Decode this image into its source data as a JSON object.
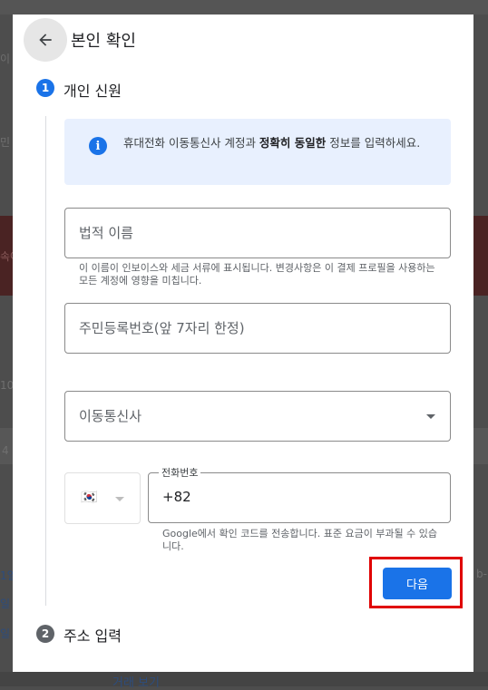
{
  "dialog": {
    "title": "본인 확인",
    "steps": [
      {
        "number": "1",
        "label": "개인 신원"
      },
      {
        "number": "2",
        "label": "주소 입력"
      }
    ],
    "info": {
      "text_before": "휴대전화 이동통신사 계정과 ",
      "text_bold": "정확히 동일한",
      "text_after": " 정보를 입력하세요."
    },
    "legal_name": {
      "placeholder": "법적 이름",
      "hint": "이 이름이 인보이스와 세금 서류에 표시됩니다. 변경사항은 이 결제 프로필을 사용하는 모든 계정에 영향을 미칩니다."
    },
    "resident_number": {
      "placeholder": "주민등록번호(앞 7자리 한정)"
    },
    "carrier": {
      "placeholder": "이동통신사"
    },
    "phone": {
      "label": "전화번호",
      "value": "+82",
      "country_flag": "🇰🇷",
      "hint": "Google에서 확인 코드를 전송합니다. 표준 요금이 부과될 수 있습니다."
    },
    "next_button": "다음"
  },
  "background": {
    "fragments": [
      "이",
      "민",
      "속어",
      "10",
      "4",
      "1일",
      "일",
      "일",
      "b-",
      "거래 보기"
    ]
  },
  "colors": {
    "accent": "#1a73e8",
    "info_bg": "#e8f0fe",
    "step_done": "#1a73e8",
    "step_pending": "#5f6368",
    "highlight": "#e00000"
  }
}
